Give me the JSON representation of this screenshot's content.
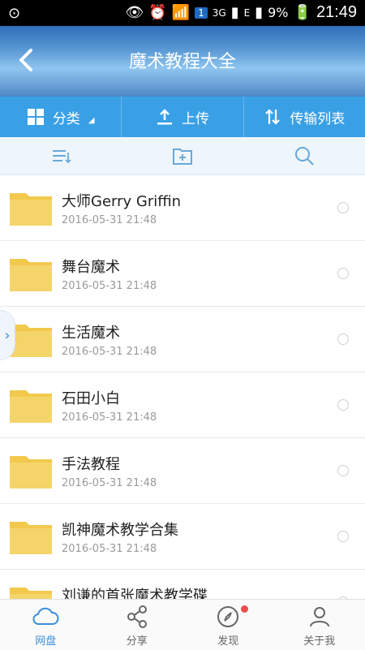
{
  "status_bar": {
    "time": "21:49",
    "battery": "9%",
    "network": "3G",
    "network_e": "E",
    "notif_badge": "1"
  },
  "header": {
    "title": "魔术教程大全"
  },
  "toolbar": {
    "category_label": "分类",
    "upload_label": "上传",
    "transfer_label": "传输列表"
  },
  "files": [
    {
      "name": "大师Gerry Griffin",
      "time": "2016-05-31  21:48"
    },
    {
      "name": "舞台魔术",
      "time": "2016-05-31  21:48"
    },
    {
      "name": "生活魔术",
      "time": "2016-05-31  21:48"
    },
    {
      "name": "石田小白",
      "time": "2016-05-31  21:48"
    },
    {
      "name": "手法教程",
      "time": "2016-05-31  21:48"
    },
    {
      "name": "凯神魔术教学合集",
      "time": "2016-05-31  21:48"
    },
    {
      "name": "刘谦的首张魔术教学碟",
      "time": ""
    }
  ],
  "bottom_nav": {
    "cloud": "网盘",
    "share": "分享",
    "discover": "发现",
    "me": "关于我"
  },
  "colors": {
    "accent": "#3aa0e6",
    "folder": "#f2c94c",
    "badge_red": "#f04b4b"
  }
}
